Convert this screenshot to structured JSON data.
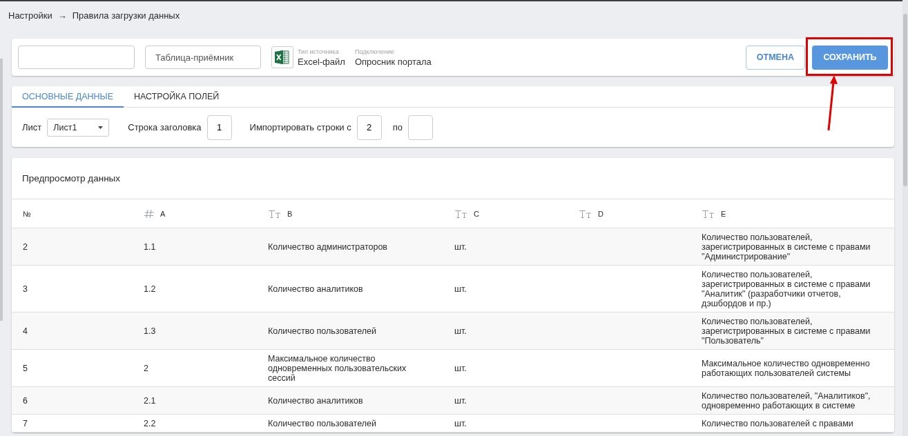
{
  "breadcrumb": {
    "items": [
      "Настройки",
      "Правила загрузки данных"
    ],
    "separator": "→"
  },
  "header": {
    "target_field": {
      "placeholder": "Таблица-приёмник"
    },
    "source_type": {
      "label": "Тип источника",
      "value": "Excel-файл"
    },
    "connection": {
      "label": "Подключение",
      "value": "Опросник портала"
    },
    "buttons": [
      {
        "label": "ОТМЕНА",
        "kind": "secondary",
        "highlighted": false
      },
      {
        "label": "СОХРАНИТЬ",
        "kind": "primary",
        "highlighted": true
      }
    ]
  },
  "tabs": [
    {
      "label": "ОСНОВНЫЕ ДАННЫЕ",
      "selected": true
    },
    {
      "label": "НАСТРОЙКА ПОЛЕЙ",
      "selected": false
    }
  ],
  "settings": {
    "sheet": {
      "label": "Лист",
      "value": "Лист1"
    },
    "header_row": {
      "label": "Строка заголовка",
      "value": "1"
    },
    "import_rows": {
      "label": "Импортировать строки с",
      "from": "2",
      "to_label": "по"
    }
  },
  "preview": {
    "title": "Предпросмотр данных",
    "columns": [
      {
        "label": "№"
      },
      {
        "label": "A",
        "kind": "number"
      },
      {
        "label": "B",
        "kind": "text"
      },
      {
        "label": "C",
        "kind": "text"
      },
      {
        "label": "D",
        "kind": "text"
      },
      {
        "label": "E",
        "kind": "text"
      }
    ],
    "rows": [
      [
        "2",
        "1.1",
        "Количество администраторов",
        "шт.",
        "",
        "Количество пользователей, зарегистрированных в системе с правами \"Администрирование\""
      ],
      [
        "3",
        "1.2",
        "Количество аналитиков",
        "шт.",
        "",
        "Количество пользователей, зарегистрированных в системе с правами \"Аналитик\" (разработчики отчетов, дэшбордов и пр.)"
      ],
      [
        "4",
        "1.3",
        "Количество пользователей",
        "шт.",
        "",
        "Количество пользователей, зарегистрированных в системе с правами \"Пользователь\""
      ],
      [
        "5",
        "2",
        "Максимальное количество одновременных пользовательских сессий",
        "шт.",
        "",
        "Максимальное количество одновременно работающих пользователей системы"
      ],
      [
        "6",
        "2.1",
        "Количество аналитиков",
        "шт.",
        "",
        "Количество пользователей, \"Аналитиков\", одновременно работающих в системе"
      ],
      [
        "7",
        "2.2",
        "Количество пользователей",
        "шт.",
        "",
        "Количество пользователей с правами"
      ]
    ]
  }
}
